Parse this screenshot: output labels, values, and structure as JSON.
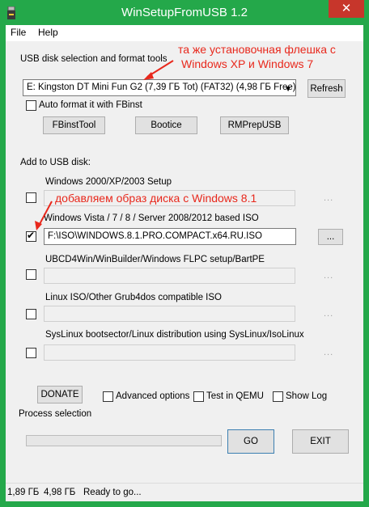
{
  "window": {
    "title": "WinSetupFromUSB 1.2",
    "close_label": "✕"
  },
  "menu": {
    "items": [
      "File",
      "Help"
    ]
  },
  "usb": {
    "section_label": "USB disk selection and format tools",
    "selected_disk": "E: Kingston DT Mini Fun G2 (7,39 ГБ Tot) (FAT32) (4,98 ГБ Free)",
    "refresh_label": "Refresh",
    "auto_format_label": "Auto format it with FBinst",
    "tools": [
      "FBinstTool",
      "Bootice",
      "RMPrepUSB"
    ]
  },
  "add": {
    "section_label": "Add to USB disk:",
    "entries": [
      {
        "label": "Windows 2000/XP/2003 Setup",
        "checked": false,
        "value": ""
      },
      {
        "label": "Windows Vista / 7 / 8 / Server 2008/2012 based ISO",
        "checked": true,
        "value": "F:\\ISO\\WINDOWS.8.1.PRO.COMPACT.x64.RU.ISO"
      },
      {
        "label": "UBCD4Win/WinBuilder/Windows FLPC setup/BartPE",
        "checked": false,
        "value": ""
      },
      {
        "label": "Linux ISO/Other Grub4dos compatible ISO",
        "checked": false,
        "value": ""
      },
      {
        "label": "SysLinux bootsector/Linux distribution using SysLinux/IsoLinux",
        "checked": false,
        "value": ""
      }
    ],
    "browse_label": "..."
  },
  "bottom": {
    "donate_label": "DONATE",
    "advanced_label": "Advanced options",
    "test_label": "Test in QEMU",
    "showlog_label": "Show Log",
    "process_label": "Process selection",
    "go_label": "GO",
    "exit_label": "EXIT"
  },
  "status": {
    "total": "1,89 ГБ",
    "free": "4,98 ГБ",
    "message": "Ready to go..."
  },
  "annotations": {
    "flash_note_line1": "та же установочная флешка с",
    "flash_note_line2": "Windows XP и Windows 7",
    "image_note": "добавляем образ диска с Windows 8.1"
  },
  "colors": {
    "title_bar": "#24a84a",
    "close_button": "#c7362b",
    "annotation": "#e8281c"
  }
}
